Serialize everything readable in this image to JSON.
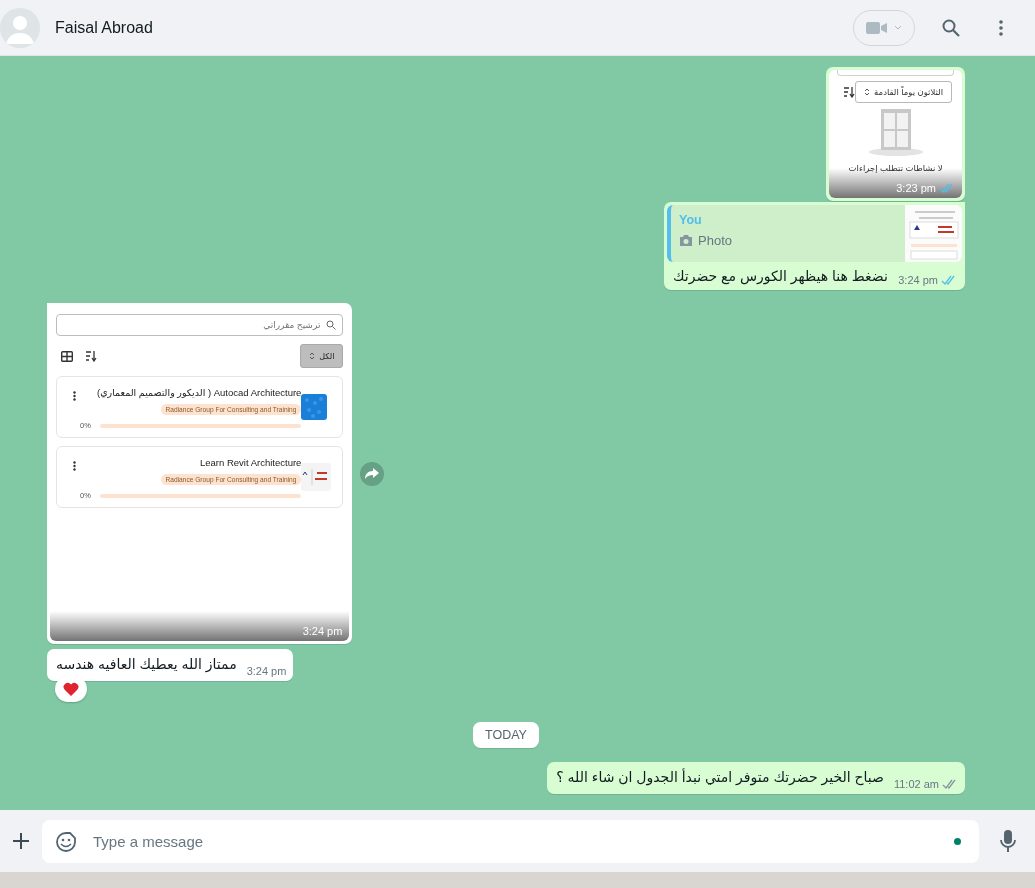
{
  "header": {
    "contact_name": "Faisal Abroad"
  },
  "messages": [
    {
      "kind": "image",
      "outgoing": true,
      "time": "3:23 pm",
      "read": true,
      "screenshot": {
        "kind": "activities",
        "filter_label": "الثلاثون يوماً القادمة",
        "empty_text": "لا نشاطات تتطلب إجراءات"
      }
    },
    {
      "kind": "reply",
      "outgoing": true,
      "quote": {
        "author": "You",
        "label": "Photo"
      },
      "text": "نضغط هنا هيظهر الكورس مع حضرتك",
      "time": "3:24 pm",
      "read": true
    },
    {
      "kind": "image",
      "outgoing": false,
      "time": "3:24 pm",
      "forward_button": true,
      "screenshot": {
        "kind": "courses",
        "search_placeholder": "ترشيح مقرراتي",
        "filter_label": "الكل",
        "courses": [
          {
            "title": "Autocad Architecture ( الديكور والتصميم المعماري)",
            "provider": "Radiance Group For Consulting and Training",
            "progress": "0%",
            "level": 0,
            "kind": "pattern"
          },
          {
            "title": "Learn Revit Architecture",
            "provider": "Radiance Group For Consulting and Training",
            "progress": "0%",
            "level": 0,
            "kind": "logo"
          }
        ]
      }
    },
    {
      "kind": "text",
      "outgoing": false,
      "text": "ممتاز الله يعطيك العافيه هندسه",
      "time": "3:24 pm",
      "reacted": true
    },
    {
      "kind": "date",
      "label": "TODAY"
    },
    {
      "kind": "text",
      "outgoing": true,
      "text": "صباح الخير حضرتك متوفر امتي نبدأ الجدول ان شاء الله ؟",
      "time": "11:02 am",
      "read": false
    }
  ],
  "composer": {
    "placeholder": "Type a message"
  }
}
